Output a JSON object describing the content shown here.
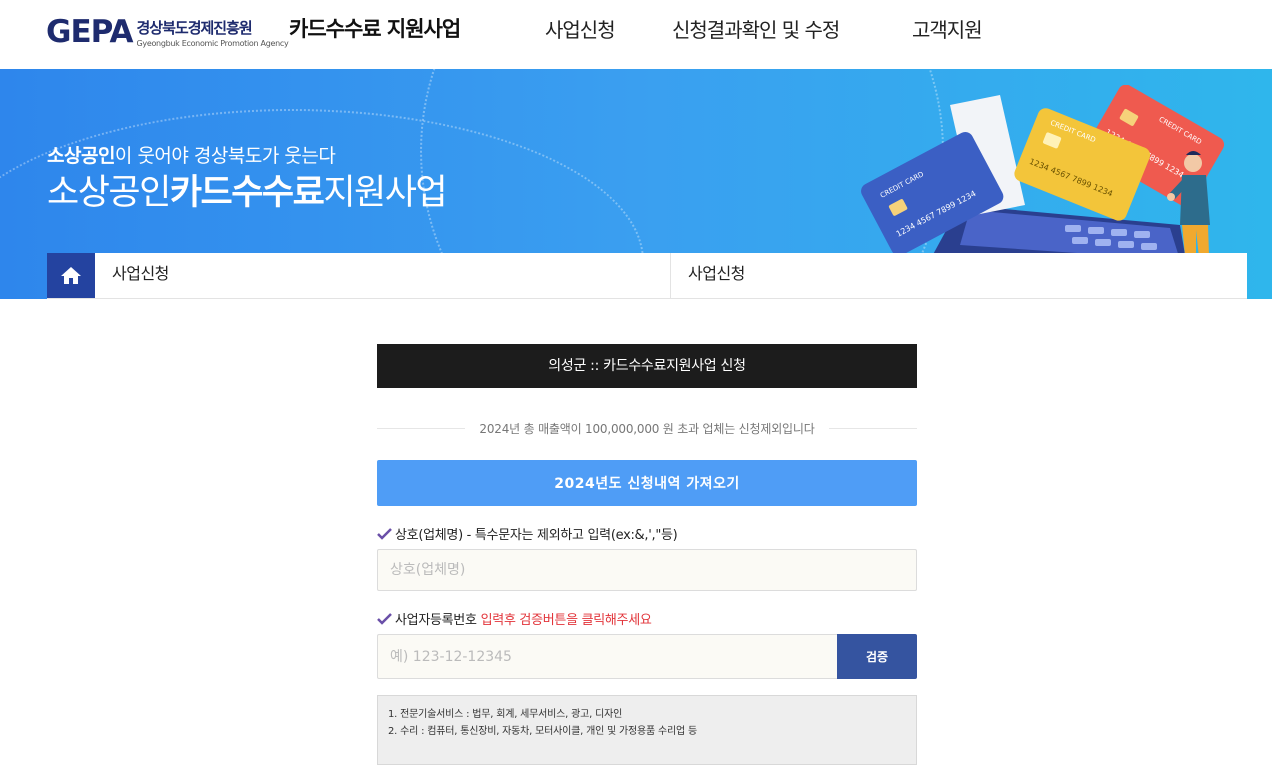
{
  "header": {
    "logo_mark": "GEPA",
    "logo_kor": "경상북도경제진흥원",
    "logo_eng": "Gyeongbuk Economic Promotion Agency",
    "site_title": "카드수수료 지원사업",
    "nav": [
      "사업신청",
      "신청결과확인 및 수정",
      "고객지원"
    ]
  },
  "banner": {
    "sub_bold": "소상공인",
    "sub_rest": "이 웃어야 경상북도가 웃는다",
    "main_pre": "소상공인",
    "main_bold": "카드수수료",
    "main_post": "지원사업",
    "card_labels": [
      "CREDIT CARD",
      "CREDIT CARD",
      "CREDIT CARD"
    ],
    "card_numbers": [
      "1234 4567 7899 1234",
      "1234 4567 7899 1234",
      "1234 4567 7899 1234"
    ],
    "colors": {
      "card_blue": "#3b5fc4",
      "card_yellow": "#f3c53a",
      "card_red": "#ef5a4f"
    }
  },
  "breadcrumb": {
    "home_icon": "home-icon",
    "left_label": "사업신청",
    "right_label": "사업신청"
  },
  "form": {
    "title": "의성군 :: 카드수수료지원사업 신청",
    "notice": "2024년 총 매출액이 100,000,000 원 초과 업체는 신청제외입니다",
    "fetch_button": "2024년도 신청내역 가져오기",
    "company_label": "상호(업체명) - 특수문자는 제외하고 입력(ex:&,',\"등)",
    "company_placeholder": "상호(업체명)",
    "biz_label": "사업자등록번호",
    "biz_label_red": "입력후 검증버튼을 클릭해주세요",
    "biz_placeholder": "예) 123-12-12345",
    "verify_button": "검증",
    "info_lines": [
      "1. 전문기술서비스 : 법무, 회계, 세무서비스, 광고, 디자인",
      "2. 수리 : 컴퓨터, 통신장비, 자동차, 모터사이클, 개인 및 가정용품 수리업 등"
    ]
  },
  "colors": {
    "accent_blue": "#4f9df6",
    "verify_blue": "#3554a0",
    "home_blue": "#2443a0",
    "title_bar": "#1c1c1c",
    "red_text": "#e2343a"
  }
}
